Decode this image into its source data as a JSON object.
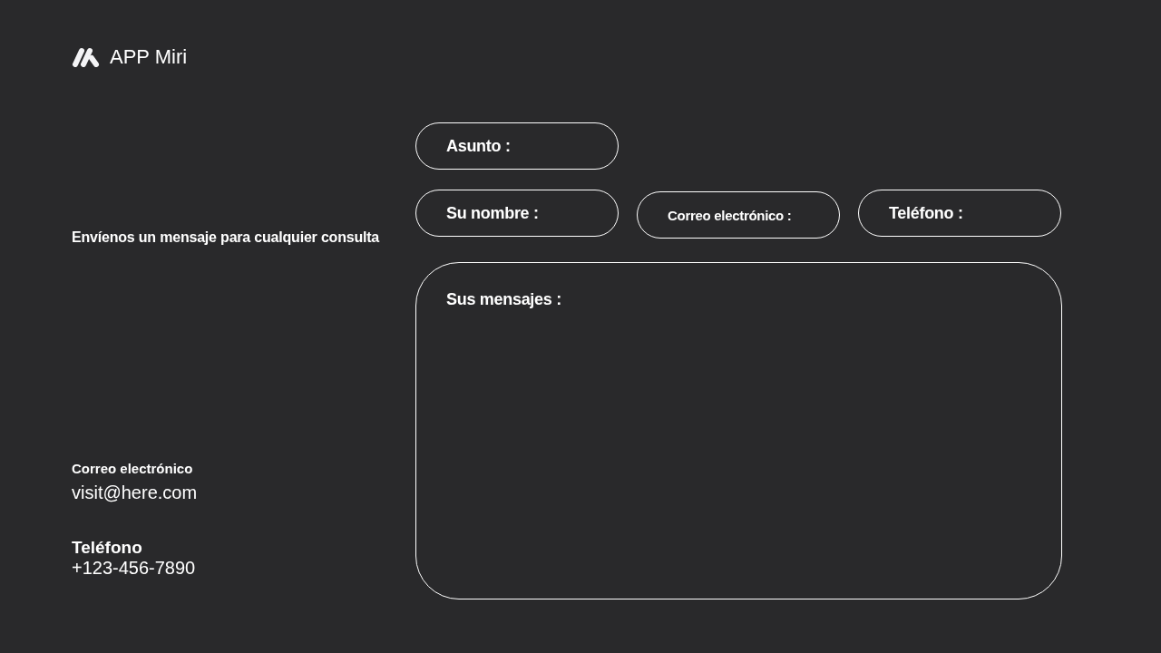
{
  "brand": {
    "name": "APP Miri"
  },
  "intro": "Envíenos un mensaje para cualquier consulta",
  "contact": [
    {
      "label": "Correo electrónico",
      "value": "visit@here.com"
    },
    {
      "label": "Teléfono",
      "value": "+123-456-7890"
    }
  ],
  "form": {
    "subject": {
      "placeholder": "Asunto :"
    },
    "name": {
      "placeholder": "Su nombre :"
    },
    "email": {
      "placeholder": "Correo electrónico :"
    },
    "phone": {
      "placeholder": "Teléfono :"
    },
    "message": {
      "placeholder": "Sus mensajes :"
    }
  }
}
